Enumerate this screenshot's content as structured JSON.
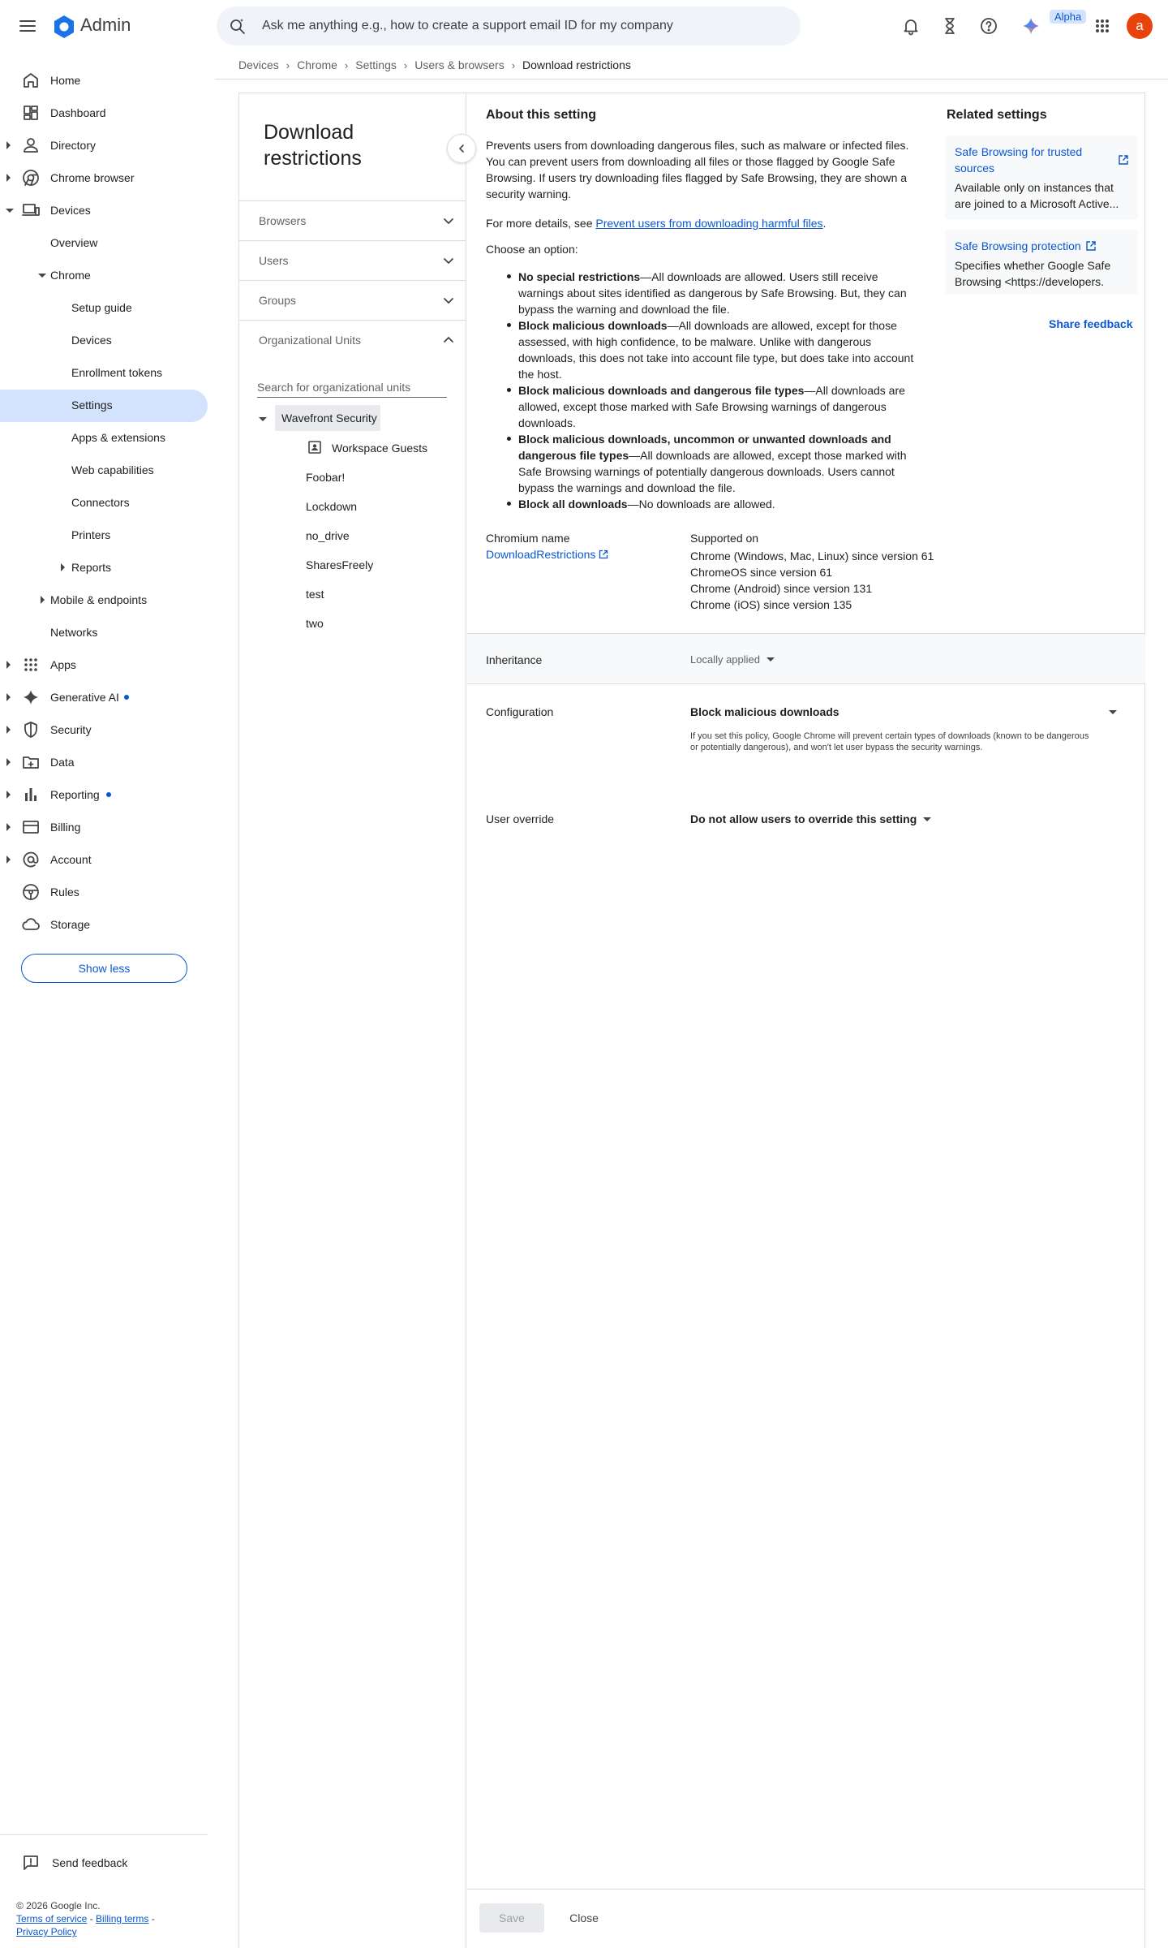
{
  "app": {
    "name": "Admin"
  },
  "header": {
    "search_placeholder": "Ask me anything e.g., how to create a support email ID for my company",
    "alpha_badge": "Alpha",
    "avatar_initial": "a"
  },
  "breadcrumb": [
    "Devices",
    "Chrome",
    "Settings",
    "Users & browsers",
    "Download restrictions"
  ],
  "nav": {
    "items": [
      {
        "label": "Home"
      },
      {
        "label": "Dashboard"
      },
      {
        "label": "Directory"
      },
      {
        "label": "Chrome browser"
      },
      {
        "label": "Devices"
      },
      {
        "label": "Overview"
      },
      {
        "label": "Chrome"
      },
      {
        "label": "Setup guide"
      },
      {
        "label": "Devices"
      },
      {
        "label": "Enrollment tokens"
      },
      {
        "label": "Settings"
      },
      {
        "label": "Apps & extensions"
      },
      {
        "label": "Web capabilities"
      },
      {
        "label": "Connectors"
      },
      {
        "label": "Printers"
      },
      {
        "label": "Reports"
      },
      {
        "label": "Mobile & endpoints"
      },
      {
        "label": "Networks"
      },
      {
        "label": "Apps"
      },
      {
        "label": "Generative AI"
      },
      {
        "label": "Security"
      },
      {
        "label": "Data"
      },
      {
        "label": "Reporting"
      },
      {
        "label": "Billing"
      },
      {
        "label": "Account"
      },
      {
        "label": "Rules"
      },
      {
        "label": "Storage"
      }
    ],
    "show_less": "Show less",
    "send_feedback": "Send feedback",
    "copyright": "© 2026 Google Inc.",
    "terms": "Terms of service",
    "billing_terms": "Billing terms",
    "privacy": "Privacy Policy"
  },
  "panel": {
    "title": "Download restrictions",
    "sections": [
      "Browsers",
      "Users",
      "Groups",
      "Organizational Units"
    ],
    "ou_search_placeholder": "Search for organizational units",
    "tree": {
      "root": "Wavefront Security",
      "children": [
        "Workspace Guests",
        "Foobar!",
        "Lockdown",
        "no_drive",
        "SharesFreely",
        "test",
        "two"
      ]
    }
  },
  "about": {
    "title": "About this setting",
    "description": "Prevents users from downloading dangerous files, such as malware or infected files. You can prevent users from downloading all files or those flagged by Google Safe Browsing. If users try downloading files flagged by Safe Browsing, they are shown a security warning.",
    "details_prefix": "For more details, see ",
    "details_link": "Prevent users from downloading harmful files",
    "details_suffix": ".",
    "choose": "Choose an option:",
    "options": [
      {
        "name": "No special restrictions",
        "text": "—All downloads are allowed. Users still receive warnings about sites identified as dangerous by Safe Browsing. But, they can bypass the warning and download the file."
      },
      {
        "name": "Block malicious downloads",
        "text": "—All downloads are allowed, except for those assessed, with high confidence, to be malware. Unlike with dangerous downloads, this does not take into account file type, but does take into account the host."
      },
      {
        "name": "Block malicious downloads and dangerous file types",
        "text": "—All downloads are allowed, except those marked with Safe Browsing warnings of dangerous downloads."
      },
      {
        "name": "Block malicious downloads, uncommon or unwanted downloads and dangerous file types",
        "text": "—All downloads are allowed, except those marked with Safe Browsing warnings of potentially dangerous downloads. Users cannot bypass the warnings and download the file."
      },
      {
        "name": "Block all downloads",
        "text": "—No downloads are allowed."
      }
    ],
    "chromium_label": "Chromium name",
    "chromium_name": "DownloadRestrictions",
    "supported_label": "Supported on",
    "supported": [
      "Chrome (Windows, Mac, Linux) since version 61",
      "ChromeOS since version 61",
      "Chrome (Android) since version 131",
      "Chrome (iOS) since version 135"
    ]
  },
  "related": {
    "title": "Related settings",
    "items": [
      {
        "link": "Safe Browsing for trusted sources",
        "desc": "Available only on instances that are joined to a Microsoft Active..."
      },
      {
        "link": "Safe Browsing protection",
        "desc": "Specifies whether Google Safe Browsing <https://developers."
      }
    ],
    "share_feedback": "Share feedback"
  },
  "settings": {
    "inheritance_label": "Inheritance",
    "inheritance_value": "Locally applied",
    "configuration_label": "Configuration",
    "configuration_value": "Block malicious downloads",
    "configuration_help": "If you set this policy, Google Chrome will prevent certain types of downloads (known to be dangerous or potentially dangerous), and won't let user bypass the security warnings.",
    "override_label": "User override",
    "override_value": "Do not allow users to override this setting"
  },
  "footer": {
    "save": "Save",
    "close": "Close"
  }
}
